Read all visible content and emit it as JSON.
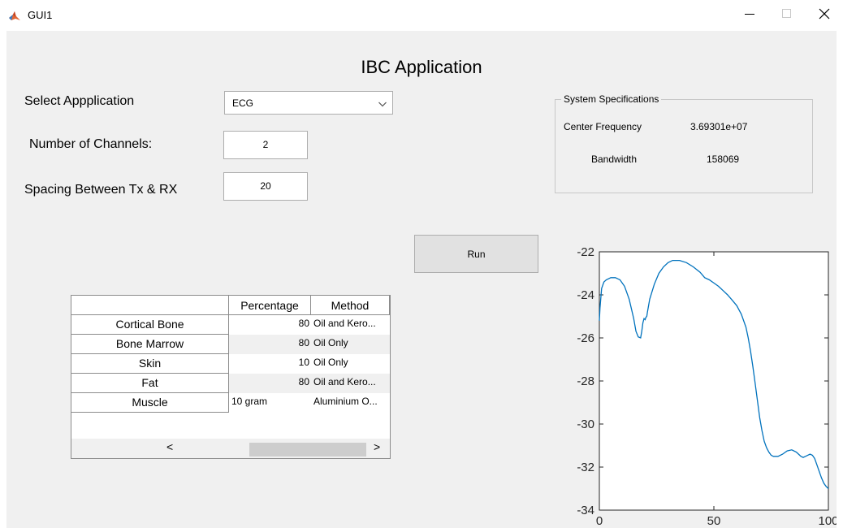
{
  "window": {
    "title": "GUI1",
    "app_icon": "matlab-icon",
    "controls": {
      "minimize": "minimize-icon",
      "maximize": "maximize-icon",
      "close": "close-icon"
    }
  },
  "app": {
    "title": "IBC Application",
    "select_label": "Select Appplication",
    "select_value": "ECG",
    "channels_label": "Number of Channels:",
    "channels_value": "2",
    "spacing_label": "Spacing Between Tx & RX",
    "spacing_value": "20",
    "run_label": "Run"
  },
  "specs": {
    "title": "System Specifications",
    "center_freq_label": "Center Frequency",
    "center_freq_value": "3.69301e+07",
    "bandwidth_label": "Bandwidth",
    "bandwidth_value": "158069"
  },
  "table": {
    "columns": [
      "Percentage",
      "Method"
    ],
    "rows": [
      {
        "name": "Cortical Bone",
        "percentage": "80",
        "method": "Oil and Kero..."
      },
      {
        "name": "Bone Marrow",
        "percentage": "80",
        "method": "Oil Only"
      },
      {
        "name": "Skin",
        "percentage": "10",
        "method": "Oil Only"
      },
      {
        "name": "Fat",
        "percentage": "80",
        "method": "Oil and Kero..."
      },
      {
        "name": "Muscle",
        "percentage": "10 gram",
        "method": "Aluminium O..."
      }
    ],
    "scroll_left": "<",
    "scroll_right": ">"
  },
  "colors": {
    "line": "#0072bd",
    "background": "#f0f0f0",
    "button": "#e1e1e1"
  },
  "chart_data": {
    "type": "line",
    "title": "",
    "xlabel": "",
    "ylabel": "",
    "xlim": [
      0,
      100
    ],
    "ylim": [
      -34,
      -22
    ],
    "xticks": [
      0,
      50,
      100
    ],
    "yticks": [
      -22,
      -24,
      -26,
      -28,
      -30,
      -32,
      -34
    ],
    "grid": false,
    "series": [
      {
        "color": "#0072bd",
        "x": [
          0,
          0.3,
          1,
          2,
          3,
          5,
          7,
          9,
          11,
          13,
          15,
          16,
          17,
          18,
          18.5,
          19,
          19.5,
          20,
          20.3,
          20.7,
          21,
          22,
          24,
          26,
          28,
          30,
          32,
          35,
          38,
          41,
          44,
          46,
          48,
          50,
          52,
          54,
          56,
          58,
          60,
          62,
          64,
          65,
          66,
          67,
          68,
          69,
          70,
          71,
          72,
          73,
          74,
          75,
          76,
          77,
          78,
          80,
          82,
          84,
          86,
          87,
          88,
          89,
          90,
          91,
          92,
          93,
          94,
          95,
          96,
          97,
          98,
          99,
          100
        ],
        "y": [
          -25.2,
          -24.6,
          -23.7,
          -23.4,
          -23.3,
          -23.2,
          -23.2,
          -23.3,
          -23.6,
          -24.2,
          -25.1,
          -25.7,
          -25.95,
          -26.0,
          -25.7,
          -25.3,
          -25.1,
          -25.15,
          -25.05,
          -25.0,
          -24.8,
          -24.2,
          -23.5,
          -23.0,
          -22.7,
          -22.5,
          -22.4,
          -22.4,
          -22.5,
          -22.7,
          -22.95,
          -23.2,
          -23.3,
          -23.45,
          -23.6,
          -23.8,
          -24.0,
          -24.25,
          -24.5,
          -24.9,
          -25.5,
          -26.0,
          -26.6,
          -27.3,
          -28.1,
          -28.9,
          -29.7,
          -30.3,
          -30.8,
          -31.1,
          -31.3,
          -31.45,
          -31.5,
          -31.5,
          -31.5,
          -31.4,
          -31.25,
          -31.2,
          -31.3,
          -31.4,
          -31.5,
          -31.55,
          -31.5,
          -31.45,
          -31.4,
          -31.45,
          -31.6,
          -31.9,
          -32.2,
          -32.5,
          -32.75,
          -32.9,
          -33.0
        ]
      }
    ]
  }
}
